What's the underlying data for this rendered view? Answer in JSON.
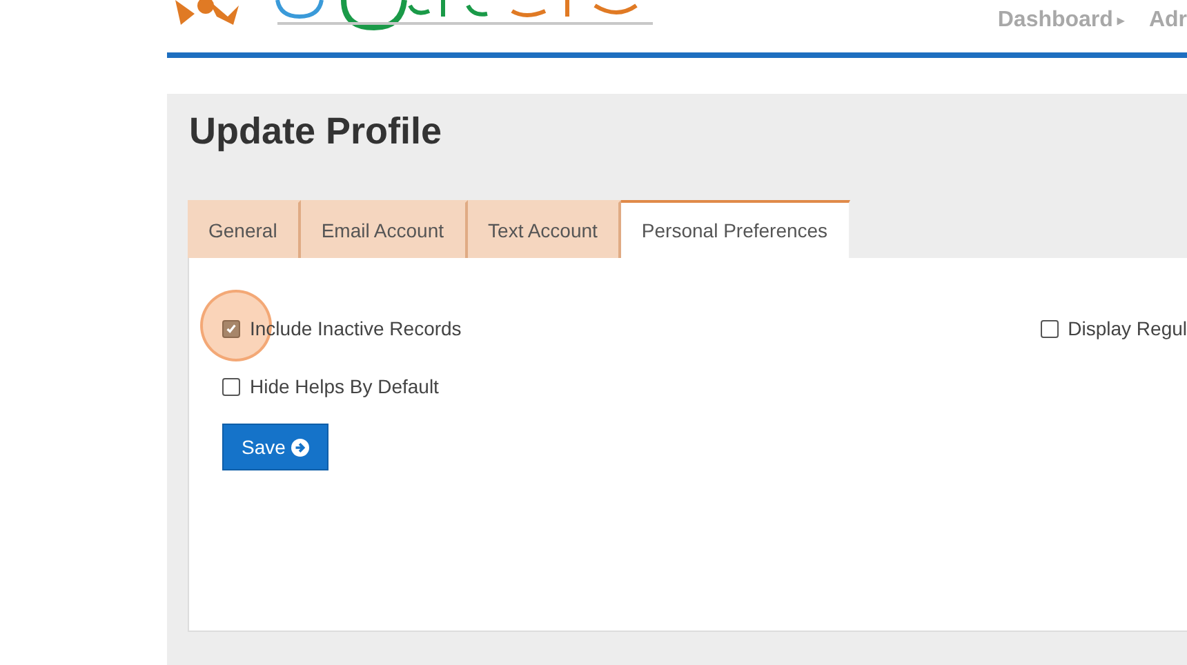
{
  "nav": [
    {
      "label": "Dashboard",
      "caret": "▸"
    },
    {
      "label": "Adr"
    }
  ],
  "title": "Update Profile",
  "tabs": [
    {
      "label": "General",
      "selected": false
    },
    {
      "label": "Email Account",
      "selected": false
    },
    {
      "label": "Text Account",
      "selected": false
    },
    {
      "label": "Personal Preferences",
      "selected": true
    }
  ],
  "options": [
    {
      "label": "Include Inactive Records",
      "checked": true,
      "highlighted": true
    },
    {
      "label": "Hide Helps By Default",
      "checked": false,
      "highlighted": false
    }
  ],
  "side_option": {
    "label": "Display Regul",
    "checked": false
  },
  "save_button": {
    "label": "Save"
  }
}
